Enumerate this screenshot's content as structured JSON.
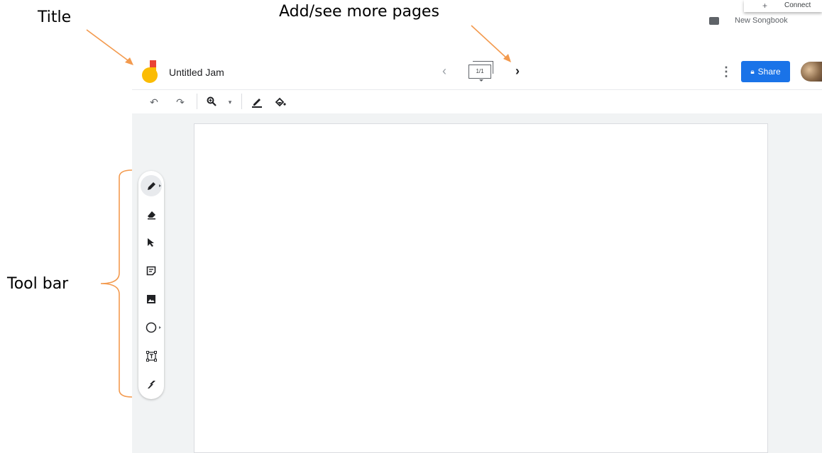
{
  "annotations": {
    "title": "Title",
    "pages": "Add/see more pages",
    "toolbar": "Tool bar",
    "color": "#f39a4e"
  },
  "background_menu": {
    "popup_item": "Connect",
    "folder_item": "New Songbook"
  },
  "header": {
    "title": "Untitled Jam",
    "page_indicator": "1/1",
    "share_label": "Share",
    "share_color": "#1a73e8"
  },
  "toolbar_top": {
    "icons": [
      "undo-icon",
      "redo-icon",
      "zoom-icon",
      "zoom-dropdown-icon",
      "pen-color-icon",
      "fill-bucket-icon"
    ]
  },
  "toolbar_left": {
    "tools": [
      "pen-tool-icon",
      "eraser-icon",
      "select-arrow-icon",
      "sticky-note-icon",
      "image-icon",
      "circle-shape-icon",
      "text-box-icon",
      "laser-icon"
    ]
  }
}
